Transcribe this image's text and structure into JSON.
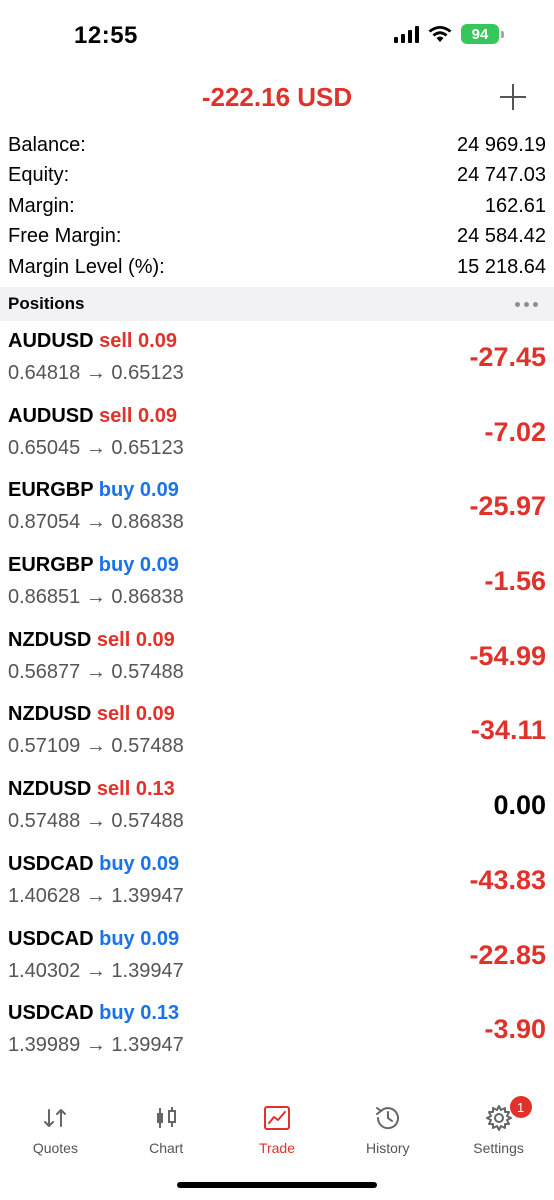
{
  "status_bar": {
    "time": "12:55",
    "battery": "94"
  },
  "header": {
    "total": "-222.16 USD"
  },
  "summary": [
    {
      "label": "Balance:",
      "value": "24 969.19"
    },
    {
      "label": "Equity:",
      "value": "24 747.03"
    },
    {
      "label": "Margin:",
      "value": "162.61"
    },
    {
      "label": "Free Margin:",
      "value": "24 584.42"
    },
    {
      "label": "Margin Level (%):",
      "value": "15 218.64"
    }
  ],
  "positions_title": "Positions",
  "positions": [
    {
      "symbol": "AUDUSD",
      "side": "sell",
      "volume": "0.09",
      "prices": "0.64818 → 0.65123",
      "profit": "-27.45"
    },
    {
      "symbol": "AUDUSD",
      "side": "sell",
      "volume": "0.09",
      "prices": "0.65045 → 0.65123",
      "profit": "-7.02"
    },
    {
      "symbol": "EURGBP",
      "side": "buy",
      "volume": "0.09",
      "prices": "0.87054 → 0.86838",
      "profit": "-25.97"
    },
    {
      "symbol": "EURGBP",
      "side": "buy",
      "volume": "0.09",
      "prices": "0.86851 → 0.86838",
      "profit": "-1.56"
    },
    {
      "symbol": "NZDUSD",
      "side": "sell",
      "volume": "0.09",
      "prices": "0.56877 → 0.57488",
      "profit": "-54.99"
    },
    {
      "symbol": "NZDUSD",
      "side": "sell",
      "volume": "0.09",
      "prices": "0.57109 → 0.57488",
      "profit": "-34.11"
    },
    {
      "symbol": "NZDUSD",
      "side": "sell",
      "volume": "0.13",
      "prices": "0.57488 → 0.57488",
      "profit": "0.00"
    },
    {
      "symbol": "USDCAD",
      "side": "buy",
      "volume": "0.09",
      "prices": "1.40628 → 1.39947",
      "profit": "-43.83"
    },
    {
      "symbol": "USDCAD",
      "side": "buy",
      "volume": "0.09",
      "prices": "1.40302 → 1.39947",
      "profit": "-22.85"
    },
    {
      "symbol": "USDCAD",
      "side": "buy",
      "volume": "0.13",
      "prices": "1.39989 → 1.39947",
      "profit": "-3.90"
    }
  ],
  "tabs": [
    {
      "label": "Quotes",
      "icon": "quotes-icon"
    },
    {
      "label": "Chart",
      "icon": "chart-icon"
    },
    {
      "label": "Trade",
      "icon": "trade-icon"
    },
    {
      "label": "History",
      "icon": "history-icon"
    },
    {
      "label": "Settings",
      "icon": "settings-icon"
    }
  ],
  "settings_badge": "1",
  "colors": {
    "negative": "#e0322b",
    "buy": "#1a73e8",
    "sell": "#e0322b",
    "active_tab": "#e0322b"
  }
}
